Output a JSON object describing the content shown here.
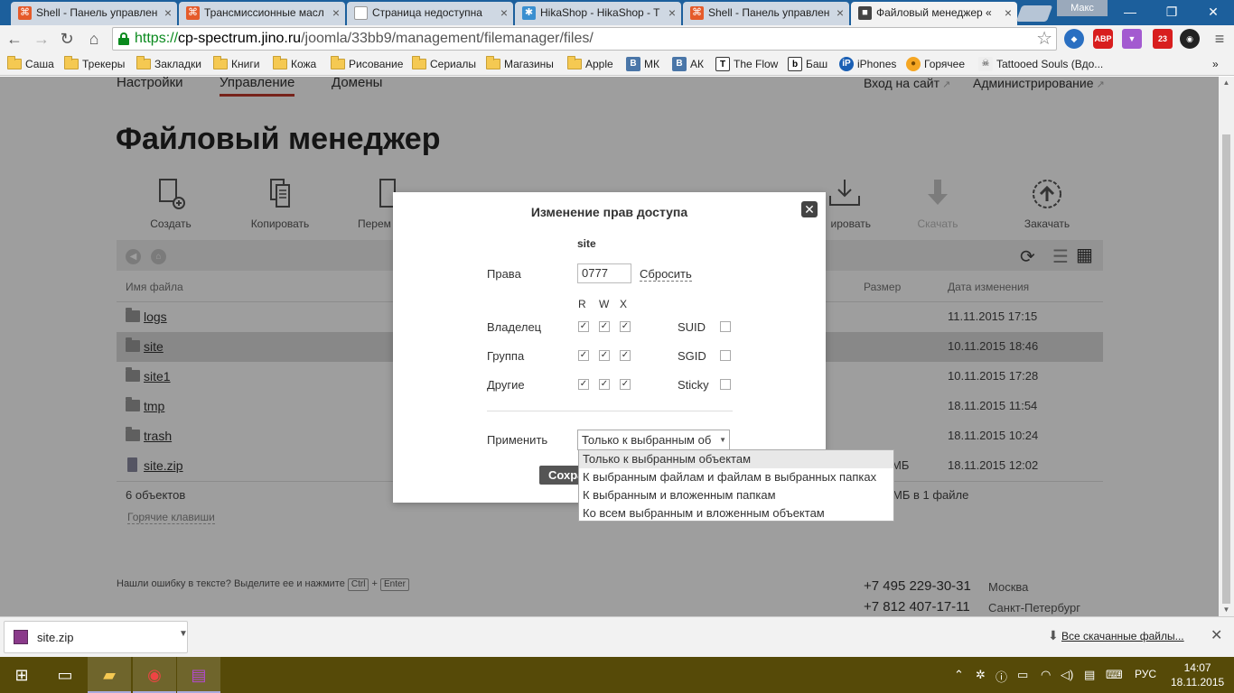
{
  "browser": {
    "tabs": [
      {
        "title": "Shell - Панель управлен",
        "icon_color": "#e55b2a"
      },
      {
        "title": "Трансмиссионные масл",
        "icon_color": "#e55b2a"
      },
      {
        "title": "Страница недоступна",
        "icon_color": "#999999"
      },
      {
        "title": "HikaShop - HikaShop - T",
        "icon_color": "#3a8fd0"
      },
      {
        "title": "Shell - Панель управлен",
        "icon_color": "#e55b2a"
      },
      {
        "title": "Файловый менеджер «",
        "icon_color": "#444444"
      }
    ],
    "profile": "Макс",
    "url_scheme": "https://",
    "url_host": "cp-spectrum.jino.ru",
    "url_path": "/joomla/33bb9/management/filemanager/files/",
    "extensions": [
      {
        "label": "ABP",
        "color": "#d81e1e"
      },
      {
        "label": "23",
        "color": "#d81e1e"
      }
    ],
    "bookmarks": [
      {
        "label": "Саша",
        "kind": "folder"
      },
      {
        "label": "Трекеры",
        "kind": "folder"
      },
      {
        "label": "Закладки",
        "kind": "folder"
      },
      {
        "label": "Книги",
        "kind": "folder"
      },
      {
        "label": "Кожа",
        "kind": "folder"
      },
      {
        "label": "Рисование",
        "kind": "folder"
      },
      {
        "label": "Сериалы",
        "kind": "folder"
      },
      {
        "label": "Магазины",
        "kind": "folder"
      },
      {
        "label": "Apple",
        "kind": "folder"
      },
      {
        "label": "МК",
        "kind": "vk",
        "glyph": "В"
      },
      {
        "label": "АК",
        "kind": "vk",
        "glyph": "В"
      },
      {
        "label": "The Flow",
        "kind": "site",
        "glyph": "Т"
      },
      {
        "label": "Баш",
        "kind": "site",
        "glyph": "b"
      },
      {
        "label": "iPhones",
        "kind": "site",
        "glyph": "iP"
      },
      {
        "label": "Горячее",
        "kind": "site",
        "glyph": "●"
      },
      {
        "label": "Tattooed Souls (Вдо...",
        "kind": "site",
        "glyph": "☠"
      }
    ]
  },
  "site": {
    "nav": [
      "Настройки",
      "Управление",
      "Домены"
    ],
    "nav_right": [
      "Вход на сайт",
      "Администрирование"
    ],
    "title": "Файловый менеджер",
    "tools": [
      {
        "label": "Создать",
        "disabled": false
      },
      {
        "label": "Копировать",
        "disabled": false
      },
      {
        "label": "Перем",
        "disabled": false
      },
      {
        "label": "ировать",
        "disabled": false
      },
      {
        "label": "Скачать",
        "disabled": true
      },
      {
        "label": "Закачать",
        "disabled": false
      }
    ],
    "columns": {
      "name": "Имя файла",
      "size": "Размер",
      "date": "Дата изменения"
    },
    "files": [
      {
        "name": "logs",
        "size": "",
        "date": "11.11.2015 17:15",
        "type": "folder"
      },
      {
        "name": "site",
        "size": "",
        "date": "10.11.2015 18:46",
        "type": "folder"
      },
      {
        "name": "site1",
        "size": "",
        "date": "10.11.2015 17:28",
        "type": "folder"
      },
      {
        "name": "tmp",
        "size": "",
        "date": "18.11.2015 11:54",
        "type": "folder"
      },
      {
        "name": "trash",
        "size": "",
        "date": "18.11.2015 10:24",
        "type": "folder"
      },
      {
        "name": "site.zip",
        "size": "МБ",
        "date": "18.11.2015 12:02",
        "type": "zip"
      }
    ],
    "count": "6 объектов",
    "summary": "МБ в 1 файле",
    "hotkeys": "Горячие клавиши",
    "footer_text": "Нашли ошибку в тексте? Выделите ее и нажмите",
    "key_ctrl": "Ctrl",
    "key_plus": "+",
    "key_enter": "Enter",
    "phones": [
      {
        "number": "+7 495 229-30-31",
        "city": "Москва"
      },
      {
        "number": "+7 812 407-17-11",
        "city": "Санкт-Петербург"
      }
    ]
  },
  "modal": {
    "title": "Изменение прав доступа",
    "object": "site",
    "rights_label": "Права",
    "rights_value": "0777",
    "reset": "Сбросить",
    "col_r": "R",
    "col_w": "W",
    "col_x": "X",
    "rows": [
      {
        "label": "Владелец",
        "r": true,
        "w": true,
        "x": true,
        "flag": "SUID",
        "flag_on": false
      },
      {
        "label": "Группа",
        "r": true,
        "w": true,
        "x": true,
        "flag": "SGID",
        "flag_on": false
      },
      {
        "label": "Другие",
        "r": true,
        "w": true,
        "x": true,
        "flag": "Sticky",
        "flag_on": false
      }
    ],
    "apply_label": "Применить",
    "apply_value": "Только к выбранным об",
    "save": "Сохра",
    "options": [
      "Только к выбранным объектам",
      "К выбранным файлам и файлам в выбранных папках",
      "К выбранным и вложенным папкам",
      "Ко всем выбранным и вложенным объектам"
    ]
  },
  "download": {
    "file": "site.zip",
    "all": "Все скачанные файлы..."
  },
  "taskbar": {
    "lang": "РУС",
    "time": "14:07",
    "date": "18.11.2015"
  }
}
